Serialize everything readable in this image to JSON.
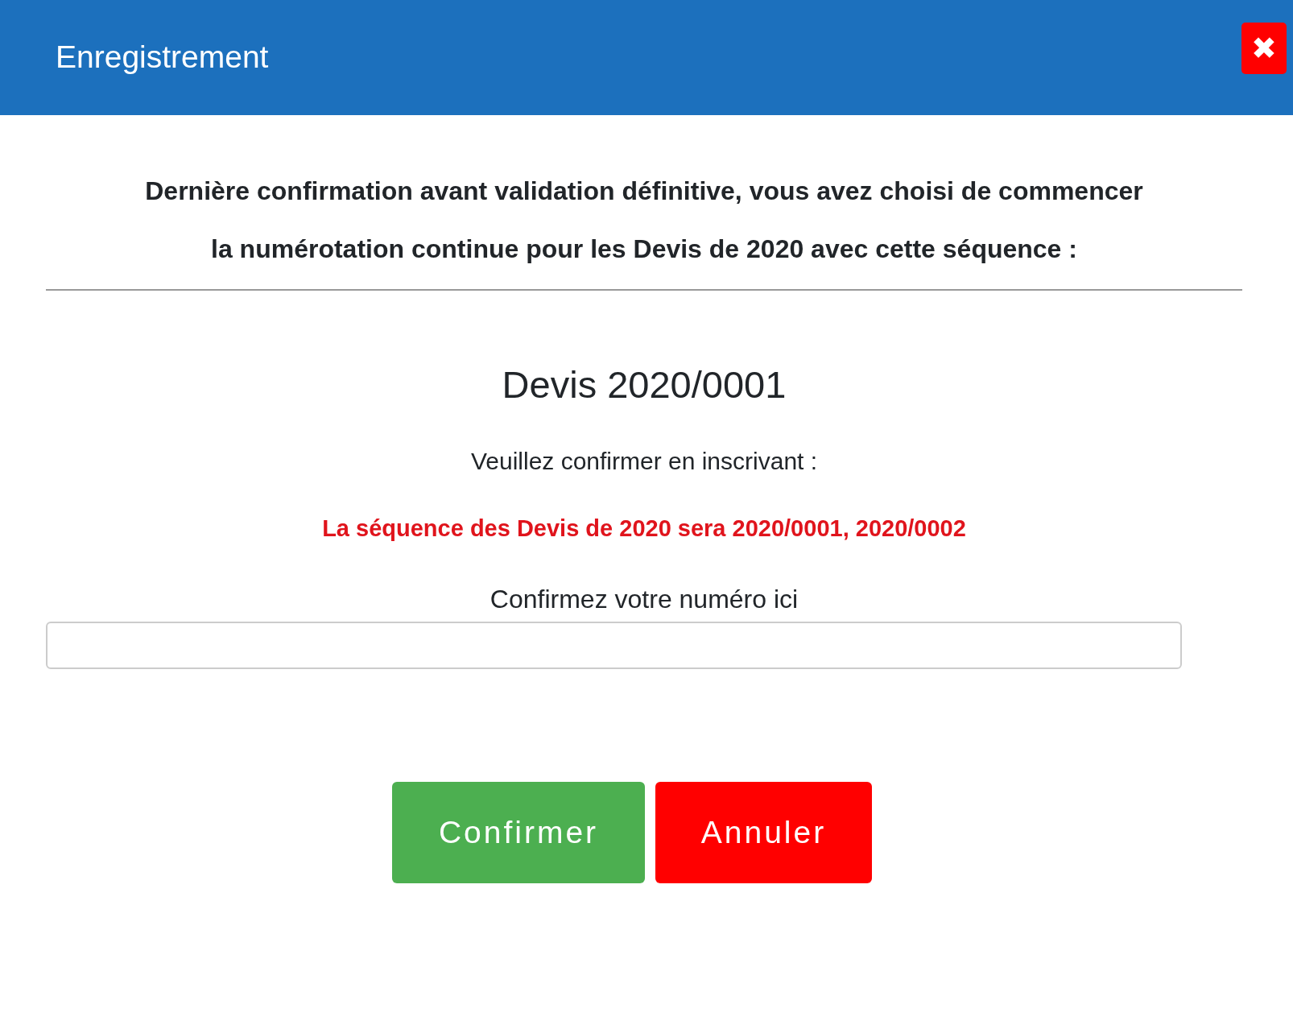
{
  "dialog": {
    "title": "Enregistrement",
    "close_label": "✖"
  },
  "message": "Dernière confirmation avant validation définitive, vous avez choisi de commencer la numérotation continue pour les Devis de 2020 avec cette séquence :",
  "sequence": "Devis 2020/0001",
  "instruction": "Veuillez confirmer en inscrivant :",
  "warning": "La séquence des Devis de 2020 sera 2020/0001, 2020/0002",
  "field": {
    "label": "Confirmez votre numéro ici"
  },
  "buttons": [
    {
      "label": "Confirmer",
      "kind": "confirm"
    },
    {
      "label": "Annuler",
      "kind": "cancel"
    }
  ]
}
